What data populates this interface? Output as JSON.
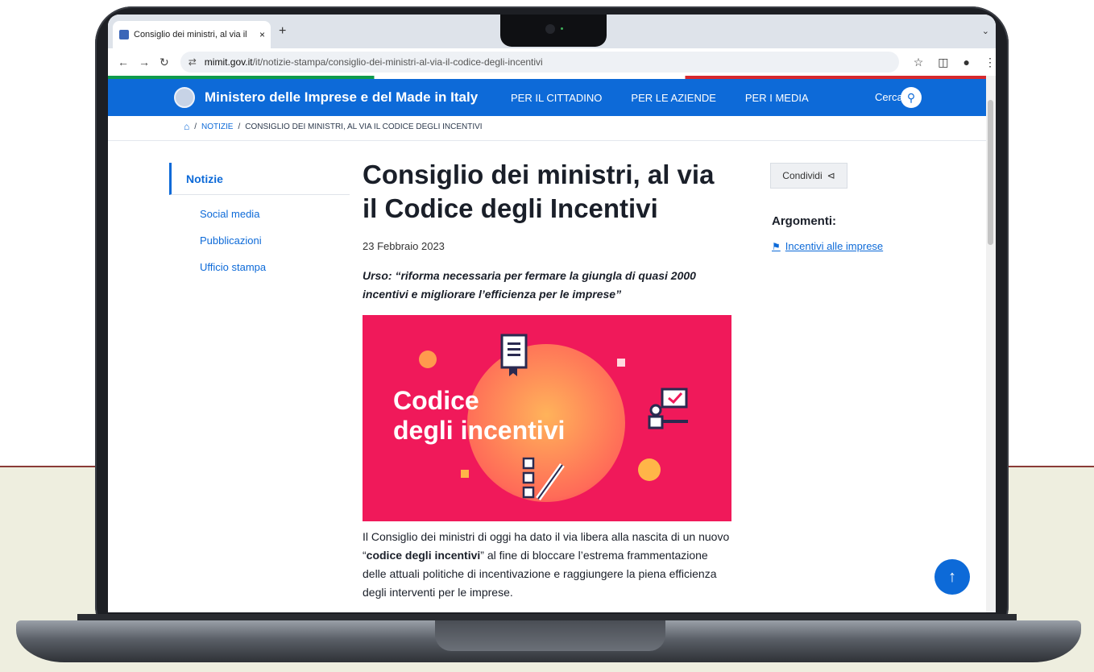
{
  "browser": {
    "tab_title": "Consiglio dei ministri, al via il",
    "tab_close": "×",
    "new_tab": "+",
    "url_host": "mimit.gov.it",
    "url_path": "/it/notizie-stampa/consiglio-dei-ministri-al-via-il-codice-degli-incentivi"
  },
  "site": {
    "title": "Ministero delle Imprese e del Made in Italy",
    "nav": [
      "PER IL CITTADINO",
      "PER LE AZIENDE",
      "PER I MEDIA"
    ],
    "search_label": "Cerca"
  },
  "breadcrumb": {
    "sep": "/",
    "items": [
      "NOTIZIE",
      "CONSIGLIO DEI MINISTRI, AL VIA IL CODICE DEGLI INCENTIVI"
    ]
  },
  "sidebar": {
    "active": "Notizie",
    "items": [
      "Social media",
      "Pubblicazioni",
      "Ufficio stampa"
    ]
  },
  "article": {
    "headline": "Consiglio dei ministri, al via il Codice degli Incentivi",
    "date": "23 Febbraio 2023",
    "lead": "Urso: “riforma necessaria per fermare la giungla di quasi 2000 incentivi e migliorare l’efficienza per le imprese”",
    "hero_text_line1": "Codice",
    "hero_text_line2": "degli incentivi",
    "body_before": "Il Consiglio dei ministri di oggi ha dato il via libera alla nascita di un nuovo “",
    "body_bold": "codice degli incentivi",
    "body_after": "” al fine di bloccare l’estrema frammentazione delle attuali politiche di incentivazione e raggiungere la piena efficienza degli interventi per le imprese."
  },
  "right": {
    "share_label": "Condividi",
    "topics_title": "Argomenti:",
    "topic_link": "Incentivi alle imprese"
  },
  "colors": {
    "primary": "#0d6ad8",
    "hero": "#f0195a",
    "bg_panel": "#eeeedf"
  }
}
